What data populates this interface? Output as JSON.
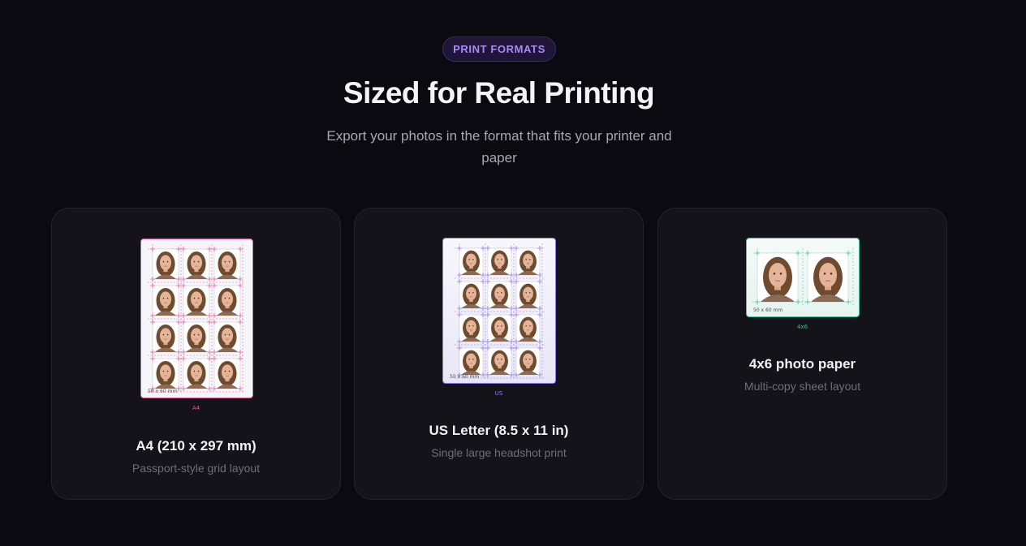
{
  "badge": "PRINT FORMATS",
  "heading": "Sized for Real Printing",
  "subheading": "Export your photos in the format that fits your printer and paper",
  "colors": {
    "accent_purple": "#a98bf2",
    "a4_guides": "#e0609b",
    "us_guides": "#8f7be8",
    "paper_4x6_guides": "#38c2a0"
  },
  "cards": [
    {
      "title": "A4 (210 x 297 mm)",
      "description": "Passport-style grid layout",
      "sheet_label": "A4",
      "photo_size": "50 x 60 mm",
      "grid": {
        "columns": 3,
        "rows": 4
      }
    },
    {
      "title": "US Letter (8.5 x 11 in)",
      "description": "Single large headshot print",
      "sheet_label": "US",
      "photo_size": "50 x 60 mm",
      "grid": {
        "columns": 3,
        "rows": 4
      }
    },
    {
      "title": "4x6 photo paper",
      "description": "Multi-copy sheet layout",
      "sheet_label": "4x6",
      "photo_size": "50 x 60 mm",
      "grid": {
        "columns": 2,
        "rows": 1
      }
    }
  ]
}
